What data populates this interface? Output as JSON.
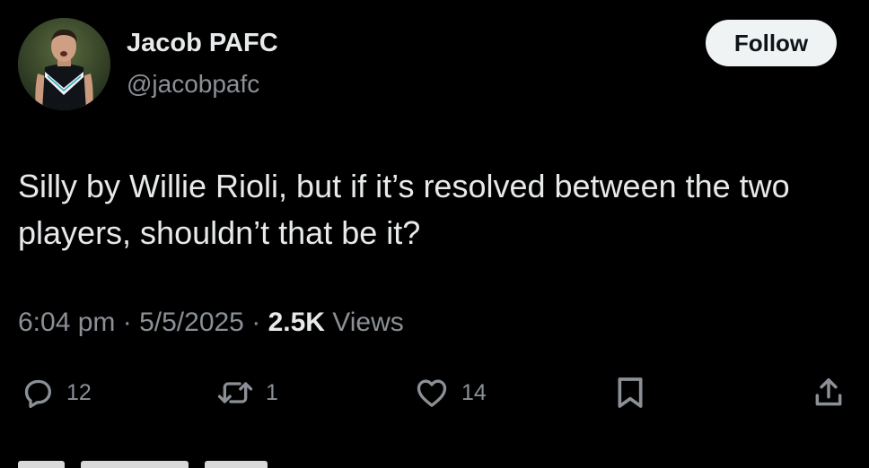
{
  "author": {
    "display_name": "Jacob PAFC",
    "handle": "@jacobpafc",
    "avatar_icon": "profile-photo"
  },
  "follow_button": {
    "label": "Follow"
  },
  "tweet": {
    "text": "Silly by Willie Rioli, but if it’s resolved between the two players, shouldn’t that be it?",
    "time": "6:04 pm",
    "separator": "·",
    "date": "5/5/2025",
    "views_count": "2.5K",
    "views_label": "Views"
  },
  "actions": {
    "replies": "12",
    "reposts": "1",
    "likes": "14"
  },
  "icons": {
    "reply": "reply-icon",
    "repost": "repost-icon",
    "like": "heart-icon",
    "bookmark": "bookmark-icon",
    "share": "share-icon"
  },
  "colors": {
    "background": "#000000",
    "primary_text": "#e7e9ea",
    "secondary_text": "#8b9096",
    "follow_button_bg": "#eff3f4",
    "follow_button_text": "#0f1419"
  }
}
